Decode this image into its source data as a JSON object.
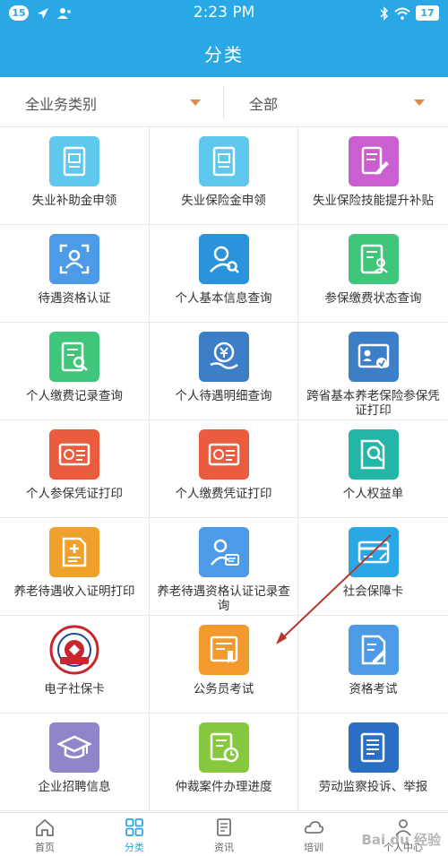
{
  "status_bar": {
    "left_badge": "15",
    "time": "2:23 PM",
    "battery": "17"
  },
  "header": {
    "title": "分类"
  },
  "filters": [
    {
      "label": "全业务类别"
    },
    {
      "label": "全部"
    }
  ],
  "colors": {
    "primary": "#2aa8e6",
    "arrow": "#e08a4a"
  },
  "services": [
    {
      "label": "失业补助金申领",
      "icon": "document-icon",
      "color": "#5ec8ee"
    },
    {
      "label": "失业保险金申领",
      "icon": "document-icon",
      "color": "#5ec8ee"
    },
    {
      "label": "失业保险技能提升补贴",
      "icon": "document-edit-icon",
      "color": "#c95fd0"
    },
    {
      "label": "待遇资格认证",
      "icon": "face-scan-icon",
      "color": "#4d9be8"
    },
    {
      "label": "个人基本信息查询",
      "icon": "user-search-icon",
      "color": "#2b93db"
    },
    {
      "label": "参保缴费状态查询",
      "icon": "form-user-icon",
      "color": "#3fc67a"
    },
    {
      "label": "个人缴费记录查询",
      "icon": "record-search-icon",
      "color": "#3fc67a"
    },
    {
      "label": "个人待遇明细查询",
      "icon": "yuan-hand-icon",
      "color": "#3d7ec9"
    },
    {
      "label": "跨省基本养老保险参保凭证打印",
      "icon": "id-card-icon",
      "color": "#3d7ec9"
    },
    {
      "label": "个人参保凭证打印",
      "icon": "card-icon",
      "color": "#ea5c3d"
    },
    {
      "label": "个人缴费凭证打印",
      "icon": "card-icon",
      "color": "#ea5c3d"
    },
    {
      "label": "个人权益单",
      "icon": "doc-search-icon",
      "color": "#23b5a8"
    },
    {
      "label": "养老待遇收入证明打印",
      "icon": "doc-plus-icon",
      "color": "#f0a12c"
    },
    {
      "label": "养老待遇资格认证记录查询",
      "icon": "user-card-icon",
      "color": "#4d9be8"
    },
    {
      "label": "社会保障卡",
      "icon": "bank-card-icon",
      "color": "#2aa8e6"
    },
    {
      "label": "电子社保卡",
      "icon": "social-security-seal-icon",
      "color": "#c8262e"
    },
    {
      "label": "公务员考试",
      "icon": "certificate-icon",
      "color": "#f39a2e"
    },
    {
      "label": "资格考试",
      "icon": "doc-pen-icon",
      "color": "#4d9be8"
    },
    {
      "label": "企业招聘信息",
      "icon": "graduation-cap-icon",
      "color": "#8f86c9"
    },
    {
      "label": "仲裁案件办理进度",
      "icon": "doc-clock-icon",
      "color": "#86c83f"
    },
    {
      "label": "劳动监察投诉、举报",
      "icon": "doc-lines-icon",
      "color": "#2b6fc4"
    }
  ],
  "tabs": [
    {
      "label": "首页",
      "icon": "home-icon"
    },
    {
      "label": "分类",
      "icon": "grid-icon",
      "active": true
    },
    {
      "label": "资讯",
      "icon": "news-icon"
    },
    {
      "label": "培训",
      "icon": "cloud-icon"
    },
    {
      "label": "个人中心",
      "icon": "person-icon"
    }
  ],
  "watermark": "Bai du 经验"
}
